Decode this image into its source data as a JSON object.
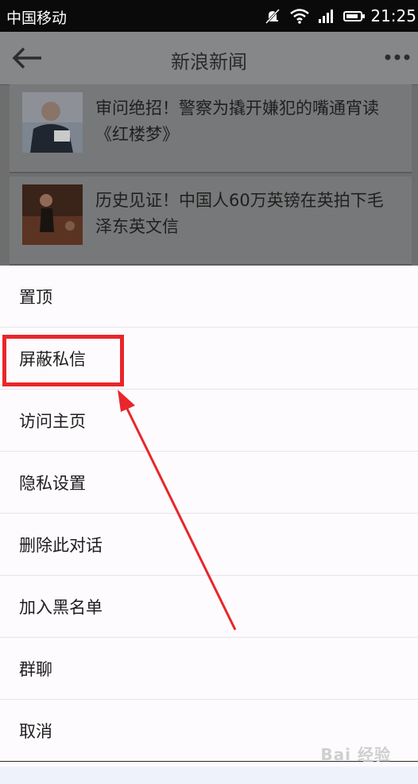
{
  "status_bar": {
    "carrier": "中国移动",
    "time": "21:25",
    "icons": [
      "bell-muted-icon",
      "wifi-icon",
      "signal-icon",
      "battery-icon"
    ]
  },
  "header": {
    "title": "新浪新闻",
    "back_icon": "back-arrow-icon",
    "more_icon": "more-dots-icon"
  },
  "news": [
    {
      "headline": "审问绝招！警察为撬开嫌犯的嘴通宵读《红楼梦》"
    },
    {
      "headline": "历史见证！中国人60万英镑在英拍下毛泽东英文信"
    }
  ],
  "action_sheet": {
    "items": [
      {
        "label": "置顶"
      },
      {
        "label": "屏蔽私信"
      },
      {
        "label": "访问主页"
      },
      {
        "label": "隐私设置"
      },
      {
        "label": "删除此对话"
      },
      {
        "label": "加入黑名单"
      },
      {
        "label": "群聊"
      },
      {
        "label": "取消"
      }
    ]
  },
  "annotation": {
    "color": "#e8262b"
  },
  "watermark": "Bai 经验"
}
